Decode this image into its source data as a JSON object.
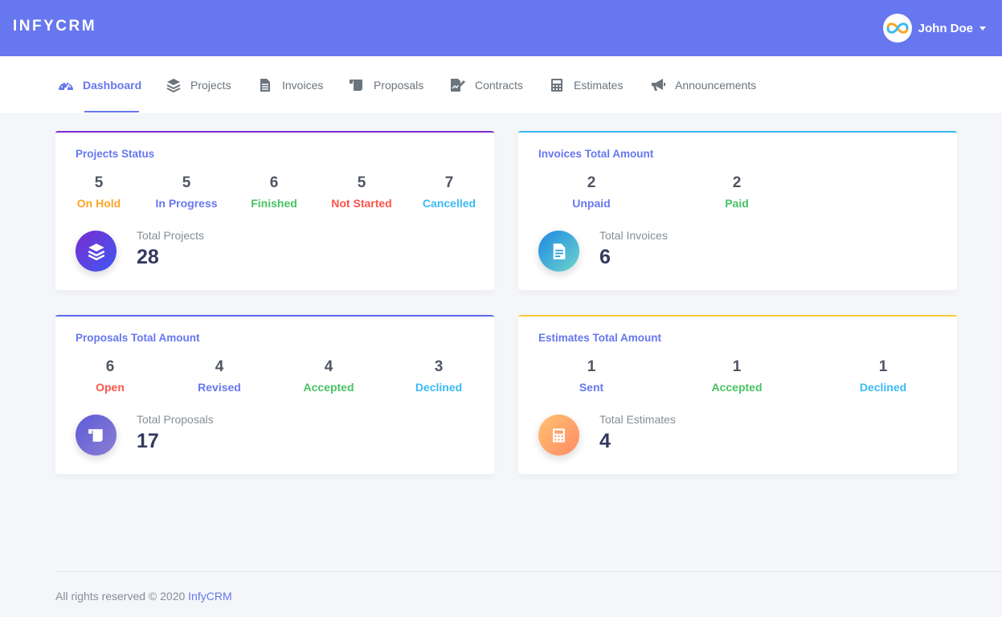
{
  "brand": "INFYCRM",
  "user": {
    "name": "John Doe"
  },
  "nav": [
    {
      "label": "Dashboard",
      "icon": "tachometer-icon",
      "active": true
    },
    {
      "label": "Projects",
      "icon": "layers-icon"
    },
    {
      "label": "Invoices",
      "icon": "file-icon"
    },
    {
      "label": "Proposals",
      "icon": "scroll-icon"
    },
    {
      "label": "Contracts",
      "icon": "file-signature-icon"
    },
    {
      "label": "Estimates",
      "icon": "calculator-icon"
    },
    {
      "label": "Announcements",
      "icon": "bullhorn-icon"
    }
  ],
  "cards": {
    "projects": {
      "title": "Projects Status",
      "stats": [
        {
          "value": "5",
          "label": "On Hold",
          "color": "#ffa426"
        },
        {
          "value": "5",
          "label": "In Progress",
          "color": "#6777ef"
        },
        {
          "value": "6",
          "label": "Finished",
          "color": "#47c363"
        },
        {
          "value": "5",
          "label": "Not Started",
          "color": "#fc544b"
        },
        {
          "value": "7",
          "label": "Cancelled",
          "color": "#3abaf4"
        }
      ],
      "total_label": "Total Projects",
      "total_value": "28"
    },
    "invoices": {
      "title": "Invoices Total Amount",
      "stats": [
        {
          "value": "2",
          "label": "Unpaid",
          "color": "#6777ef"
        },
        {
          "value": "2",
          "label": "Paid",
          "color": "#47c363"
        }
      ],
      "total_label": "Total Invoices",
      "total_value": "6"
    },
    "proposals": {
      "title": "Proposals Total Amount",
      "stats": [
        {
          "value": "6",
          "label": "Open",
          "color": "#fc544b"
        },
        {
          "value": "4",
          "label": "Revised",
          "color": "#6777ef"
        },
        {
          "value": "4",
          "label": "Accepted",
          "color": "#47c363"
        },
        {
          "value": "3",
          "label": "Declined",
          "color": "#3abaf4"
        }
      ],
      "total_label": "Total Proposals",
      "total_value": "17"
    },
    "estimates": {
      "title": "Estimates Total Amount",
      "stats": [
        {
          "value": "1",
          "label": "Sent",
          "color": "#6777ef"
        },
        {
          "value": "1",
          "label": "Accepted",
          "color": "#47c363"
        },
        {
          "value": "1",
          "label": "Declined",
          "color": "#3abaf4"
        }
      ],
      "total_label": "Total Estimates",
      "total_value": "4"
    }
  },
  "footer": {
    "text": "All rights reserved © 2020",
    "link": "InfyCRM"
  },
  "colors": {
    "primary": "#6777ef",
    "warning": "#ffa426",
    "success": "#47c363",
    "danger": "#fc544b",
    "info": "#3abaf4"
  }
}
